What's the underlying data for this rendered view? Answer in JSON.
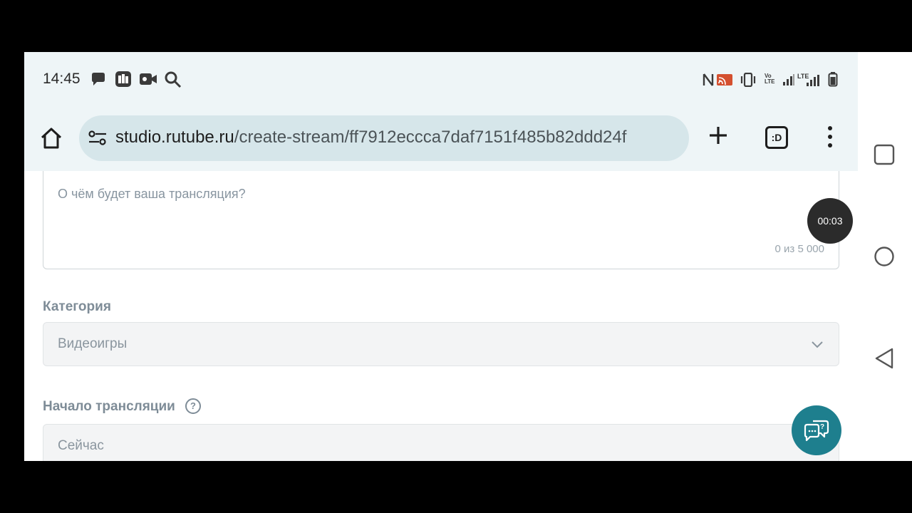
{
  "status_bar": {
    "time": "14:45",
    "left_icons": [
      "chat-bubble-icon",
      "wallet-app-icon",
      "video-camera-icon",
      "search-icon"
    ],
    "right_icons": [
      "nfc-icon",
      "cast-icon",
      "vibrate-icon",
      "volte-icon",
      "signal-icon",
      "lte-signal-icon",
      "battery-icon"
    ],
    "volte_text": "Vo LTE",
    "lte_text": "LTE"
  },
  "browser": {
    "url_domain": "studio.rutube.ru",
    "url_path": "/create-stream/ff7912eccca7daf7151f485b82ddd24f",
    "tabs_label": ":D"
  },
  "form": {
    "description": {
      "placeholder": "О чём будет ваша трансляция?",
      "counter": "0 из 5 000"
    },
    "category": {
      "label": "Категория",
      "value": "Видеоигры"
    },
    "start": {
      "label": "Начало трансляции",
      "help": "?",
      "value": "Сейчас"
    }
  },
  "overlay": {
    "recording_timer": "00:03"
  },
  "colors": {
    "browser_chrome": "#eef5f7",
    "omnibox": "#d6e6ea",
    "support_button": "#1e7f8e",
    "label_gray": "#7e8c97"
  }
}
